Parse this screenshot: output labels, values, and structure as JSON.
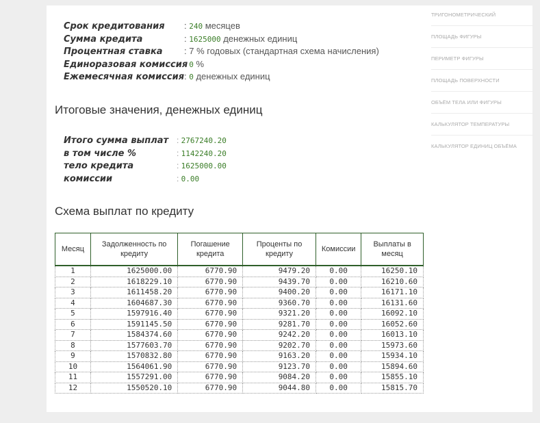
{
  "params": [
    {
      "label": "Срок кредитования",
      "prefix": ": ",
      "num": "240",
      "suffix": " месяцев"
    },
    {
      "label": "Сумма кредита",
      "prefix": ": ",
      "num": "1625000",
      "suffix": " денежных единиц"
    },
    {
      "label": "Процентная ставка",
      "prefix": ": ",
      "num": "",
      "suffix": "7 % годовых (стандартная схема начисления)"
    },
    {
      "label": "Единоразовая комиссия",
      "prefix": ": ",
      "num": "0",
      "suffix": " %"
    },
    {
      "label": "Ежемесячная комиссия",
      "prefix": ": ",
      "num": "0",
      "suffix": " денежных единиц"
    }
  ],
  "totals_title": "Итоговые значения, денежных единиц",
  "totals": [
    {
      "label": "Итого сумма выплат",
      "value": "2767240.20"
    },
    {
      "label": "в том числе %",
      "value": "1142240.20"
    },
    {
      "label": "тело кредита",
      "value": "1625000.00"
    },
    {
      "label": "комиссии",
      "value": "0.00"
    }
  ],
  "schedule_title": "Схема выплат по кредиту",
  "table": {
    "headers": [
      "Месяц",
      "Задолженность по кредиту",
      "Погашение кредита",
      "Проценты по кредиту",
      "Комиссии",
      "Выплаты в месяц"
    ],
    "rows": [
      [
        "1",
        "1625000.00",
        "6770.90",
        "9479.20",
        "0.00",
        "16250.10"
      ],
      [
        "2",
        "1618229.10",
        "6770.90",
        "9439.70",
        "0.00",
        "16210.60"
      ],
      [
        "3",
        "1611458.20",
        "6770.90",
        "9400.20",
        "0.00",
        "16171.10"
      ],
      [
        "4",
        "1604687.30",
        "6770.90",
        "9360.70",
        "0.00",
        "16131.60"
      ],
      [
        "5",
        "1597916.40",
        "6770.90",
        "9321.20",
        "0.00",
        "16092.10"
      ],
      [
        "6",
        "1591145.50",
        "6770.90",
        "9281.70",
        "0.00",
        "16052.60"
      ],
      [
        "7",
        "1584374.60",
        "6770.90",
        "9242.20",
        "0.00",
        "16013.10"
      ],
      [
        "8",
        "1577603.70",
        "6770.90",
        "9202.70",
        "0.00",
        "15973.60"
      ],
      [
        "9",
        "1570832.80",
        "6770.90",
        "9163.20",
        "0.00",
        "15934.10"
      ],
      [
        "10",
        "1564061.90",
        "6770.90",
        "9123.70",
        "0.00",
        "15894.60"
      ],
      [
        "11",
        "1557291.00",
        "6770.90",
        "9084.20",
        "0.00",
        "15855.10"
      ],
      [
        "12",
        "1550520.10",
        "6770.90",
        "9044.80",
        "0.00",
        "15815.70"
      ]
    ]
  },
  "sidebar": [
    "Тригонометрический",
    "Площадь фигуры",
    "Периметр фигуры",
    "Площадь поверхности",
    "Объём тела или фигуры",
    "Калькулятор температуры",
    "Калькулятор единиц объёма"
  ]
}
